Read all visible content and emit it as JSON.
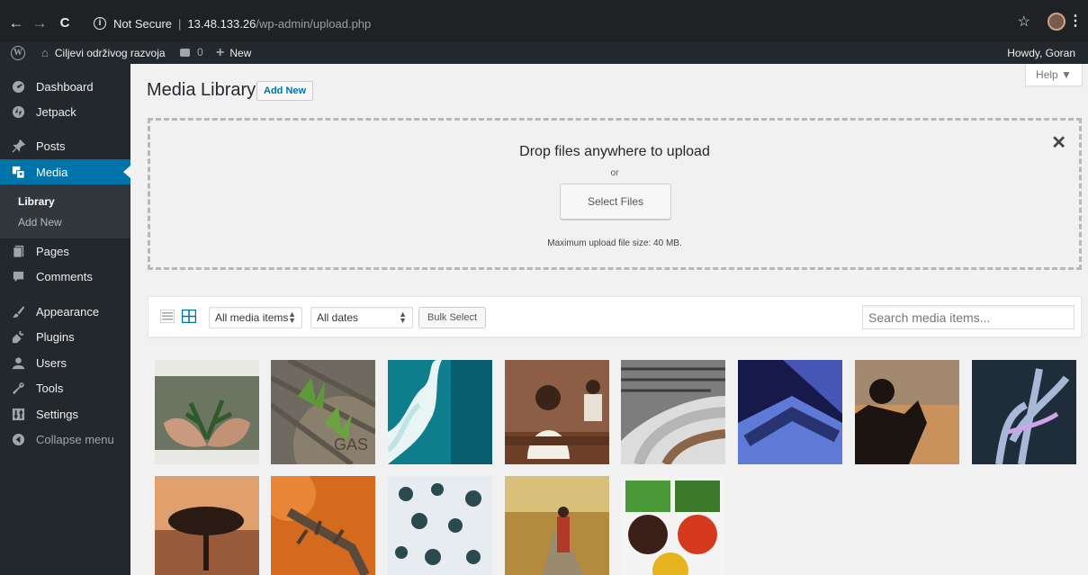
{
  "browser": {
    "back": "←",
    "forward": "→",
    "reload": "C",
    "security_label": "Not Secure",
    "host": "13.48.133.26",
    "path": "/wp-admin/upload.php",
    "star": "☆",
    "menu": "⋮"
  },
  "adminbar": {
    "site_name": "Ciljevi održivog razvoja",
    "comment_count": "0",
    "new_label": "New",
    "howdy": "Howdy, Goran"
  },
  "sidebar": {
    "items": [
      {
        "label": "Dashboard",
        "icon": "dashboard-icon"
      },
      {
        "label": "Jetpack",
        "icon": "jetpack-icon"
      },
      {
        "label": "Posts",
        "icon": "pin-icon"
      },
      {
        "label": "Media",
        "icon": "media-icon"
      },
      {
        "label": "Pages",
        "icon": "pages-icon"
      },
      {
        "label": "Comments",
        "icon": "comments-icon"
      },
      {
        "label": "Appearance",
        "icon": "brush-icon"
      },
      {
        "label": "Plugins",
        "icon": "plugin-icon"
      },
      {
        "label": "Users",
        "icon": "users-icon"
      },
      {
        "label": "Tools",
        "icon": "wrench-icon"
      },
      {
        "label": "Settings",
        "icon": "settings-icon"
      },
      {
        "label": "Collapse menu",
        "icon": "collapse-icon"
      }
    ],
    "submenu": {
      "library": "Library",
      "add_new": "Add New"
    }
  },
  "main": {
    "title": "Media Library",
    "add_new": "Add New",
    "help": "Help ▼",
    "upload": {
      "title": "Drop files anywhere to upload",
      "or": "or",
      "select_files": "Select Files",
      "max_size": "Maximum upload file size: 40 MB.",
      "close": "✕"
    },
    "toolbar": {
      "filter_type": "All media items",
      "filter_date": "All dates",
      "bulk_select": "Bulk Select",
      "search_placeholder": "Search media items..."
    }
  },
  "colors": {
    "accent": "#0073aa",
    "adminbar": "#23282d",
    "submenu": "#32373c"
  },
  "media_items": [
    "hands-holding-plant",
    "gas-manhole-cover-with-plants",
    "ocean-waves-aerial",
    "girl-in-classroom",
    "library-bookshelves",
    "laptop-blue-light",
    "silhouette-reading-sunset",
    "x-ray-hand",
    "acacia-tree-sunset",
    "lizard-on-red-sand",
    "snowy-trees-aerial",
    "person-on-autumn-road",
    "vegetable-bowls"
  ]
}
